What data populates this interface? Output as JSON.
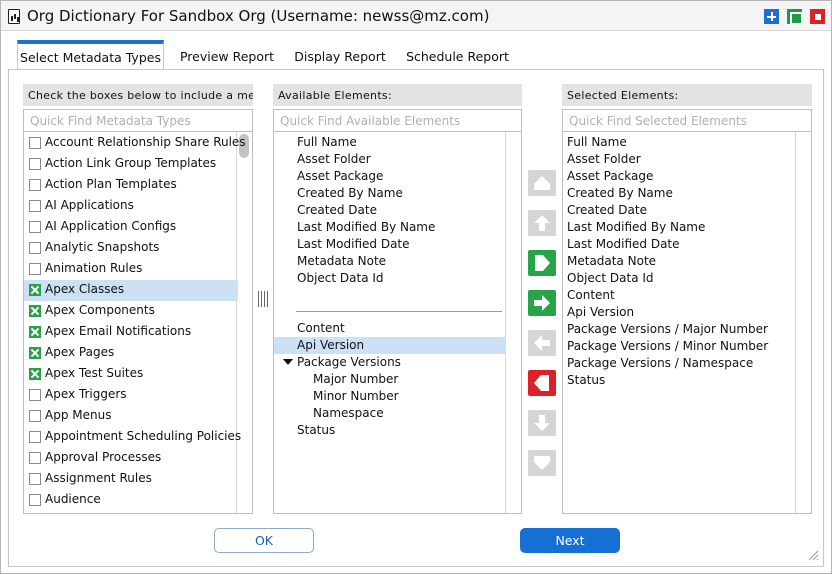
{
  "window": {
    "title": "Org Dictionary For Sandbox Org (Username: newss@mz.com)",
    "icon": "report-document-icon",
    "controls": [
      "maximize-icon",
      "restore-icon",
      "close-icon"
    ]
  },
  "tabs": [
    {
      "label": "Select Metadata Types",
      "active": true
    },
    {
      "label": "Preview Report",
      "active": false
    },
    {
      "label": "Display Report",
      "active": false
    },
    {
      "label": "Schedule Report",
      "active": false
    }
  ],
  "types_panel": {
    "header": "Check the boxes below to include a me",
    "search_placeholder": "Quick Find Metadata Types",
    "items": [
      {
        "label": "Account Relationship Share Rules",
        "checked": false,
        "selected": false
      },
      {
        "label": "Action Link Group Templates",
        "checked": false,
        "selected": false
      },
      {
        "label": "Action Plan Templates",
        "checked": false,
        "selected": false
      },
      {
        "label": "AI Applications",
        "checked": false,
        "selected": false
      },
      {
        "label": "AI Application Configs",
        "checked": false,
        "selected": false
      },
      {
        "label": "Analytic Snapshots",
        "checked": false,
        "selected": false
      },
      {
        "label": "Animation Rules",
        "checked": false,
        "selected": false
      },
      {
        "label": "Apex Classes",
        "checked": true,
        "selected": true
      },
      {
        "label": "Apex Components",
        "checked": true,
        "selected": false
      },
      {
        "label": "Apex Email Notifications",
        "checked": true,
        "selected": false
      },
      {
        "label": "Apex Pages",
        "checked": true,
        "selected": false
      },
      {
        "label": "Apex Test Suites",
        "checked": true,
        "selected": false
      },
      {
        "label": "Apex Triggers",
        "checked": false,
        "selected": false
      },
      {
        "label": "App Menus",
        "checked": false,
        "selected": false
      },
      {
        "label": "Appointment Scheduling Policies",
        "checked": false,
        "selected": false
      },
      {
        "label": "Approval Processes",
        "checked": false,
        "selected": false
      },
      {
        "label": "Assignment Rules",
        "checked": false,
        "selected": false
      },
      {
        "label": "Audience",
        "checked": false,
        "selected": false
      }
    ]
  },
  "available_panel": {
    "header": "Available Elements:",
    "search_placeholder": "Quick Find Available Elements",
    "group_top": [
      "Full Name",
      "Asset Folder",
      "Asset Package",
      "Created By Name",
      "Created Date",
      "Last Modified By Name",
      "Last Modified Date",
      "Metadata Note",
      "Object Data Id"
    ],
    "group_bottom": [
      {
        "label": "Content",
        "level": 0,
        "selected": false,
        "expander": false
      },
      {
        "label": "Api Version",
        "level": 0,
        "selected": true,
        "expander": false
      },
      {
        "label": "Package Versions",
        "level": 0,
        "selected": false,
        "expander": true
      },
      {
        "label": "Major Number",
        "level": 1,
        "selected": false,
        "expander": false
      },
      {
        "label": "Minor Number",
        "level": 1,
        "selected": false,
        "expander": false
      },
      {
        "label": "Namespace",
        "level": 1,
        "selected": false,
        "expander": false
      },
      {
        "label": "Status",
        "level": 0,
        "selected": false,
        "expander": false
      }
    ]
  },
  "selected_panel": {
    "header": "Selected Elements:",
    "search_placeholder": "Quick Find Selected Elements",
    "items": [
      "Full Name",
      "Asset Folder",
      "Asset Package",
      "Created By Name",
      "Created Date",
      "Last Modified By Name",
      "Last Modified Date",
      "Metadata Note",
      "Object Data Id",
      "Content",
      "Api Version",
      "Package Versions / Major Number",
      "Package Versions / Minor Number",
      "Package Versions / Namespace",
      "Status"
    ]
  },
  "transfer_controls": [
    {
      "name": "move-top-button",
      "icon": "move-top-icon",
      "enabled": false
    },
    {
      "name": "move-up-button",
      "icon": "arrow-up-icon",
      "enabled": false
    },
    {
      "name": "add-all-button",
      "icon": "add-all-icon",
      "enabled": true
    },
    {
      "name": "add-button",
      "icon": "arrow-right-icon",
      "enabled": true
    },
    {
      "name": "remove-button",
      "icon": "arrow-left-icon",
      "enabled": false
    },
    {
      "name": "remove-all-button",
      "icon": "remove-all-icon",
      "enabled": true
    },
    {
      "name": "move-down-button",
      "icon": "arrow-down-icon",
      "enabled": false
    },
    {
      "name": "move-bottom-button",
      "icon": "move-bottom-icon",
      "enabled": false
    }
  ],
  "buttons": {
    "ok": "OK",
    "next": "Next"
  },
  "colors": {
    "accent": "#1670d3",
    "check": "#29a148",
    "remove": "#dc2128",
    "selection": "#cce0f6"
  }
}
